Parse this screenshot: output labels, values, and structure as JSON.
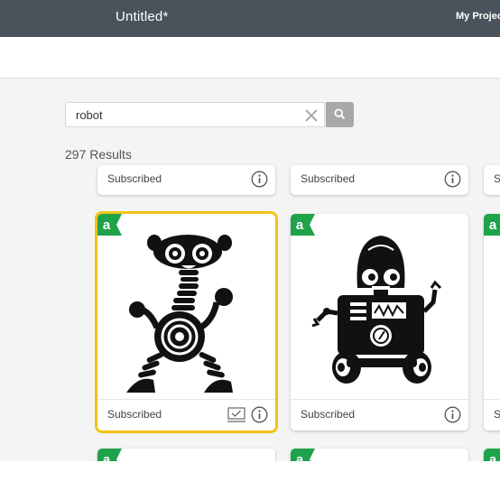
{
  "header": {
    "document_title": "Untitled*",
    "projects_label": "My Projects"
  },
  "search": {
    "value": "robot",
    "clear_icon": "close-icon",
    "submit_icon": "search-icon"
  },
  "results": {
    "count_text": "297 Results"
  },
  "cards": {
    "status_label": "Subscribed",
    "badge_letter": "a",
    "row1": [
      {
        "label": "Subscribed"
      },
      {
        "label": "Subscribed"
      },
      {
        "label": "Su"
      }
    ],
    "row2": [
      {
        "label": "Subscribed",
        "selected": true,
        "image": "robot-with-spiral-body"
      },
      {
        "label": "Subscribed",
        "selected": false,
        "image": "robot-with-dome-head"
      },
      {
        "label": "Su"
      }
    ],
    "row3_badge": [
      "a",
      "a",
      "a"
    ]
  },
  "colors": {
    "topbar": "#4a535b",
    "selection": "#f2c318",
    "badge": "#1fa34a",
    "search_button": "#a8a8a8"
  }
}
